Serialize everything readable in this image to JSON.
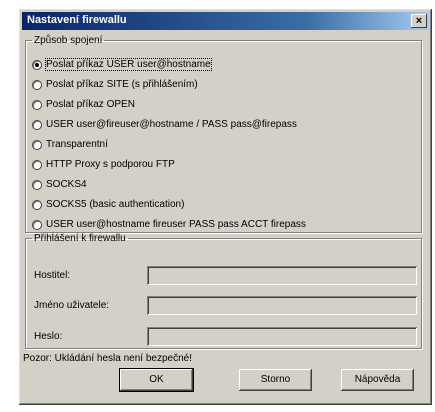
{
  "window": {
    "title": "Nastavení firewallu",
    "close_label": "×"
  },
  "connection_group": {
    "legend": "Způsob spojení",
    "options": [
      {
        "label": "Poslat příkaz USER user@hostname",
        "selected": true
      },
      {
        "label": "Poslat příkaz SITE (s přihlášením)",
        "selected": false
      },
      {
        "label": "Poslat příkaz OPEN",
        "selected": false
      },
      {
        "label": "USER user@fireuser@hostname / PASS pass@firepass",
        "selected": false
      },
      {
        "label": "Transparentní",
        "selected": false
      },
      {
        "label": "HTTP Proxy s podporou FTP",
        "selected": false
      },
      {
        "label": "SOCKS4",
        "selected": false
      },
      {
        "label": "SOCKS5 (basic authentication)",
        "selected": false
      },
      {
        "label": "USER user@hostname fireuser PASS pass ACCT firepass",
        "selected": false
      }
    ]
  },
  "login_group": {
    "legend": "Přihlášení k firewallu",
    "host_label": "Hostitel:",
    "host_value": "",
    "user_label": "Jméno uživatele:",
    "user_value": "",
    "password_label": "Heslo:",
    "password_value": ""
  },
  "warning": "Pozor: Ukládání hesla není bezpečné!",
  "buttons": {
    "ok": "OK",
    "cancel": "Storno",
    "help": "Nápověda"
  },
  "colors": {
    "title_bar": "#0a246a",
    "dialog_face": "#d4d0c8"
  }
}
